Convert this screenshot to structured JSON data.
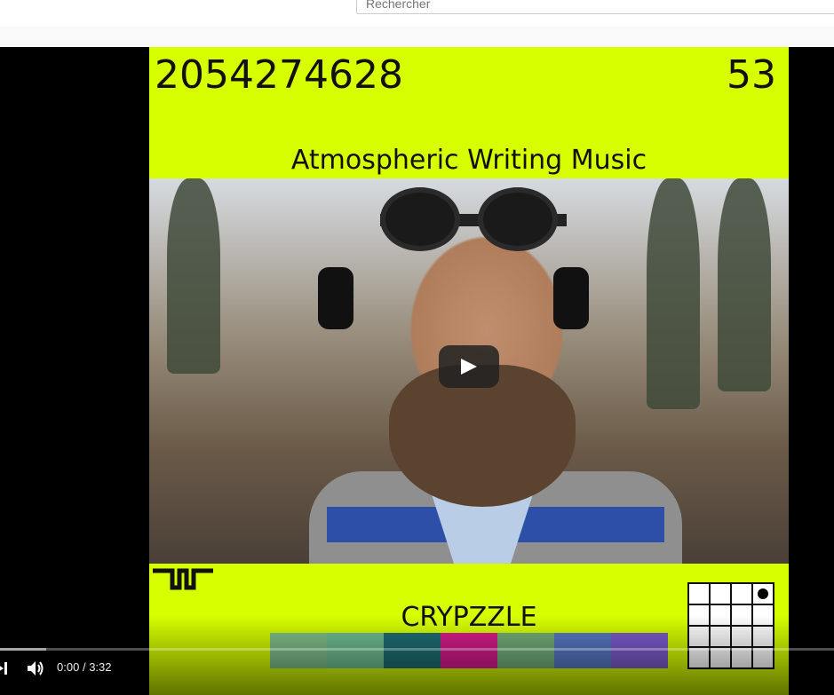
{
  "header": {
    "search_placeholder": "Rechercher"
  },
  "video": {
    "cover": {
      "number_left": "2054274628",
      "number_right": "53",
      "title": "Atmospheric Writing Music",
      "artist": "CRYPZZLE",
      "background_color": "#d7ff00",
      "swatch_colors": [
        "#7fc08a",
        "#6fbf93",
        "#1e6e74",
        "#d81b8c",
        "#73b07a",
        "#5878c4",
        "#7d5bcc"
      ]
    },
    "controls": {
      "current_time": "0:00",
      "separator": "/",
      "duration": "3:32",
      "progress": 0.0,
      "loaded_fraction": 0.055,
      "icons": [
        "next-icon",
        "volume-icon",
        "play-icon"
      ]
    }
  }
}
